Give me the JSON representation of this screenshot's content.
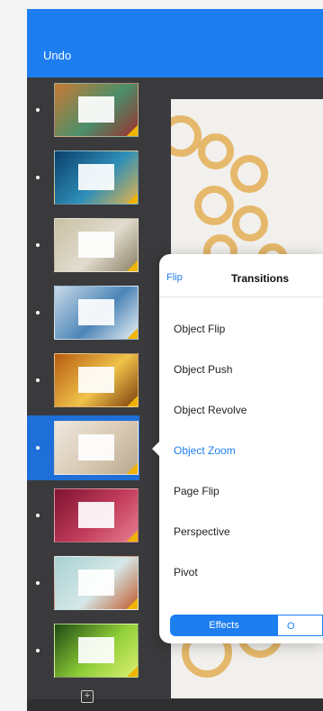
{
  "navbar": {
    "undo_label": "Undo"
  },
  "thumbnails": [
    {
      "colors": [
        "#c97a34",
        "#4b8f6a",
        "#9b2f2f"
      ],
      "selected": false
    },
    {
      "colors": [
        "#0a3f6b",
        "#2e8fb8",
        "#e3b24b"
      ],
      "selected": false
    },
    {
      "colors": [
        "#c8c0a3",
        "#e1dccf",
        "#8a7f62"
      ],
      "selected": false
    },
    {
      "colors": [
        "#c9d9e8",
        "#4c86b8",
        "#e9eef3"
      ],
      "selected": false
    },
    {
      "colors": [
        "#b85b11",
        "#f0c34a",
        "#7a3e0c"
      ],
      "selected": false
    },
    {
      "colors": [
        "#efe8df",
        "#d8c9b3",
        "#b9a88e"
      ],
      "selected": true
    },
    {
      "colors": [
        "#7d1430",
        "#c33d5c",
        "#e67f92"
      ],
      "selected": false
    },
    {
      "colors": [
        "#a8d1d2",
        "#d5e7e7",
        "#c0582a"
      ],
      "selected": false
    },
    {
      "colors": [
        "#1e4a14",
        "#8fcf37",
        "#ddef72"
      ],
      "selected": false
    }
  ],
  "popover": {
    "back_label": "Flip",
    "title": "Transitions",
    "items": [
      "Object Flip",
      "Object Push",
      "Object Revolve",
      "Object Zoom",
      "Page Flip",
      "Perspective",
      "Pivot"
    ],
    "active_item": "Object Zoom",
    "segments": {
      "left": "Effects",
      "right": "O"
    }
  },
  "colors": {
    "accent": "#1d7ef0"
  },
  "icons": {
    "add_slide": "+"
  }
}
